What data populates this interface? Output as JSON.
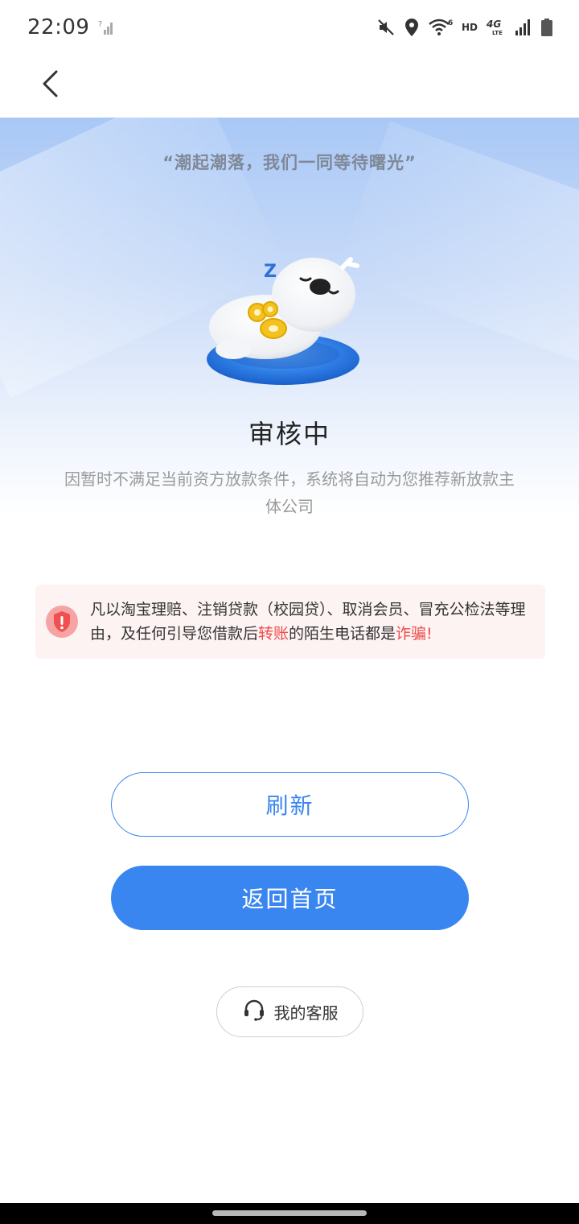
{
  "status_bar": {
    "time": "22:09",
    "hd_label": "HD",
    "network_label": "4G",
    "network_sub": "LTE",
    "wifi_sup": "6",
    "icons": [
      "signal-question-icon",
      "mute-icon",
      "location-icon",
      "wifi-icon",
      "signal-icon",
      "battery-icon"
    ]
  },
  "nav": {
    "back_icon": "chevron-left-icon"
  },
  "hero": {
    "quote": "“潮起潮落，我们一同等待曙光”",
    "mascot_text": "Z"
  },
  "status": {
    "title": "审核中",
    "description": "因暂时不满足当前资方放款条件，系统将自动为您推荐新放款主体公司"
  },
  "warning": {
    "icon": "shield-alert-icon",
    "text_part1": "凡以淘宝理赔、注销贷款（校园贷）、取消会员、冒充公检法等理由，及任何引导您借款后",
    "highlight1": "转账",
    "text_part2": "的陌生电话都是",
    "highlight2": "诈骗!",
    "highlight_color": "#f04b4b"
  },
  "buttons": {
    "refresh_label": "刷新",
    "home_label": "返回首页",
    "service_label": "我的客服"
  },
  "colors": {
    "primary": "#3a86f0",
    "warning_bg": "#fdf3f3"
  }
}
